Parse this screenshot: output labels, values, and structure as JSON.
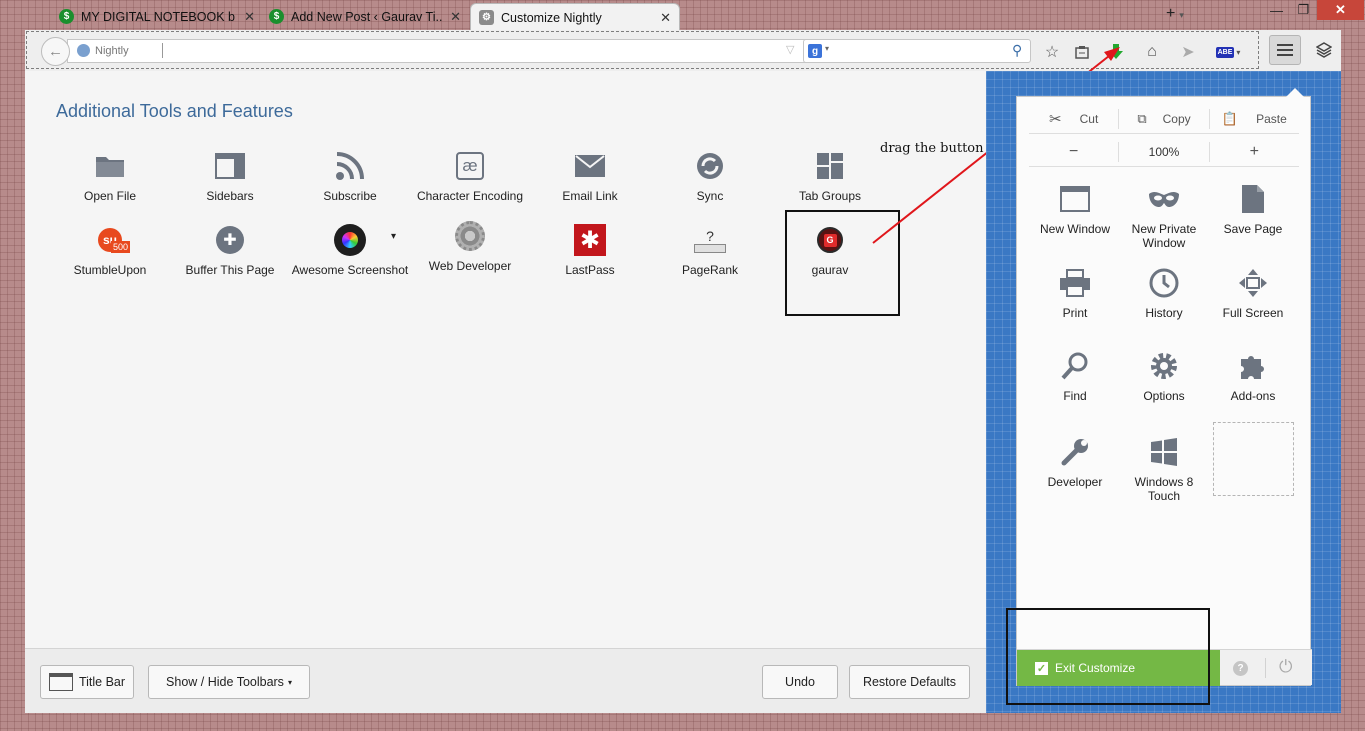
{
  "tabs": [
    {
      "title": "MY DIGITAL NOTEBOOK b...",
      "icon": "green-s-favicon-icon"
    },
    {
      "title": "Add New Post ‹ Gaurav Ti...",
      "icon": "green-s-favicon-icon"
    },
    {
      "title": "Customize Nightly",
      "icon": "customize-gear-icon",
      "active": true
    }
  ],
  "tab_close": "✕",
  "new_tab": "+",
  "window_controls": {
    "minimize": "—",
    "maximize": "❐",
    "close": "✕"
  },
  "navbar": {
    "url_placeholder": "Nightly",
    "search_engine": "g",
    "back_icon": "back-arrow-icon"
  },
  "heading": "Additional Tools and Features",
  "tools": [
    {
      "label": "Open File",
      "icon": "folder-icon"
    },
    {
      "label": "Sidebars",
      "icon": "sidebar-icon"
    },
    {
      "label": "Subscribe",
      "icon": "rss-icon"
    },
    {
      "label": "Character Encoding",
      "icon": "ae-icon"
    },
    {
      "label": "Email Link",
      "icon": "envelope-icon"
    },
    {
      "label": "Sync",
      "icon": "sync-icon"
    },
    {
      "label": "Tab Groups",
      "icon": "tab-groups-icon"
    },
    {
      "label": "StumbleUpon",
      "icon": "stumbleupon-icon",
      "badge": "500"
    },
    {
      "label": "Buffer This Page",
      "icon": "buffer-icon"
    },
    {
      "label": "Awesome Screenshot",
      "icon": "screenshot-icon"
    },
    {
      "label": "Web Developer",
      "icon": "gear-webdev-icon"
    },
    {
      "label": "LastPass",
      "icon": "lastpass-icon"
    },
    {
      "label": "PageRank",
      "icon": "pagerank-icon",
      "glyph": "?"
    },
    {
      "label": "gaurav",
      "icon": "gaurav-icon",
      "glyph": "G"
    }
  ],
  "annotation": "drag the button",
  "bottom_buttons": {
    "title_bar": "Title Bar",
    "show_hide": "Show / Hide Toolbars",
    "undo": "Undo",
    "restore": "Restore Defaults"
  },
  "panel": {
    "edit": {
      "cut": "Cut",
      "copy": "Copy",
      "paste": "Paste"
    },
    "zoom": {
      "minus": "−",
      "value": "100%",
      "plus": "+"
    },
    "items": [
      {
        "label": "New Window",
        "icon": "window-icon"
      },
      {
        "label": "New Private Window",
        "icon": "mask-icon"
      },
      {
        "label": "Save Page",
        "icon": "page-icon"
      },
      {
        "label": "Print",
        "icon": "printer-icon"
      },
      {
        "label": "History",
        "icon": "clock-icon"
      },
      {
        "label": "Full Screen",
        "icon": "fullscreen-icon"
      },
      {
        "label": "Find",
        "icon": "magnifier-icon"
      },
      {
        "label": "Options",
        "icon": "gear-icon"
      },
      {
        "label": "Add-ons",
        "icon": "puzzle-icon"
      },
      {
        "label": "Developer",
        "icon": "wrench-icon"
      },
      {
        "label": "Windows 8 Touch",
        "icon": "windows-icon"
      }
    ],
    "exit_customize": "Exit Customize",
    "help_icon": "?",
    "power_icon": "⏻"
  },
  "colors": {
    "heading": "#3d6a9a",
    "blueprint": "#3a78c4",
    "exit_green": "#74b845",
    "arrow": "#e0161b"
  }
}
